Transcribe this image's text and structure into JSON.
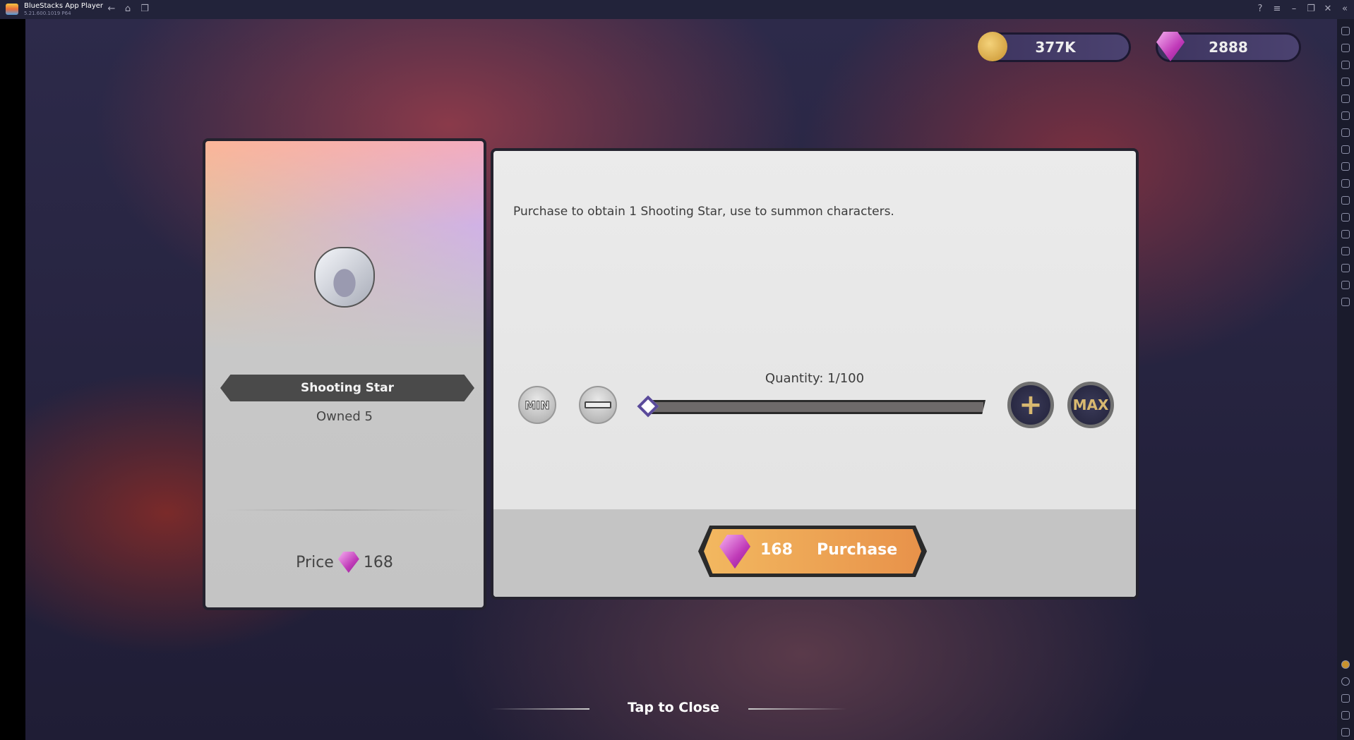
{
  "titlebar": {
    "app_name": "BlueStacks App Player",
    "version": "5.21.600.1019 P64"
  },
  "currency": {
    "coins": "377K",
    "gems": "2888"
  },
  "item": {
    "name": "Shooting Star",
    "owned": "Owned 5",
    "price_label": "Price",
    "price": "168"
  },
  "panel": {
    "description": "Purchase to obtain 1 Shooting Star, use to summon characters.",
    "quantity": "Quantity: 1/100",
    "quantity_value": 1,
    "quantity_max": 100,
    "min_label": "MIN",
    "max_label": "MAX",
    "purchase_cost": "168",
    "purchase_label": "Purchase"
  },
  "footer": {
    "close_label": "Tap to Close"
  },
  "colors": {
    "accent": "#e8924a",
    "gem": "#c03ab8",
    "panel": "#e8e8e8"
  }
}
